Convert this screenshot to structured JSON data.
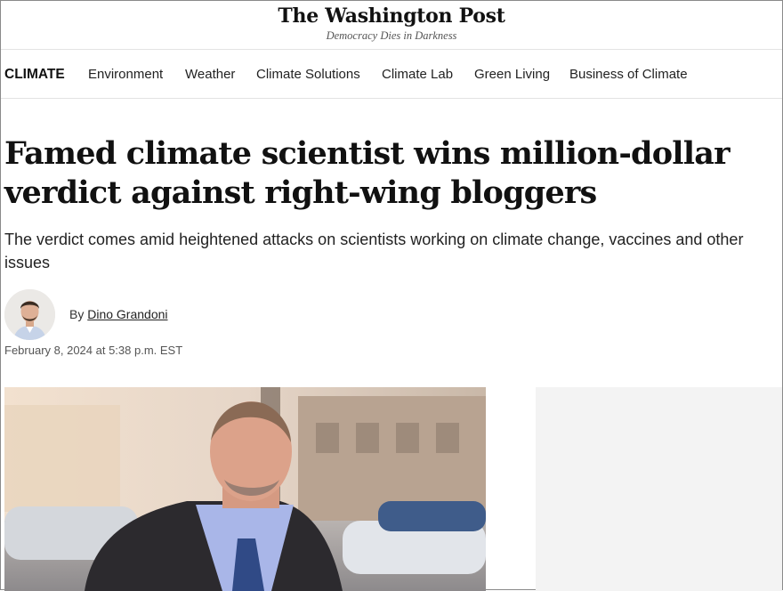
{
  "masthead": {
    "logo": "The Washington Post",
    "tagline": "Democracy Dies in Darkness"
  },
  "nav": {
    "section": "CLIMATE",
    "items": [
      "Environment",
      "Weather",
      "Climate Solutions",
      "Climate Lab",
      "Green Living",
      "Business of Climate"
    ]
  },
  "article": {
    "headline": "Famed climate scientist wins million-dollar verdict against right-wing bloggers",
    "dek": "The verdict comes amid heightened attacks on scientists working on climate change, vaccines and other issues",
    "byline_prefix": "By",
    "author": "Dino Grandoni",
    "date": "February 8, 2024 at 5:38 p.m. EST"
  },
  "colors": {
    "text": "#111111",
    "divider": "#e3e3e3",
    "ad_bg": "#f3f3f3"
  }
}
